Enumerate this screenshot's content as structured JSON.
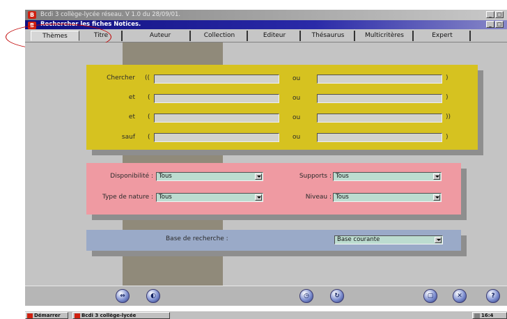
{
  "window": {
    "title": "Bcdi 3 collège-lycée réseau. V 1.0 du 28/09/01.",
    "inner_title": "Rechercher les fiches Notices."
  },
  "tabs": [
    {
      "label": "Thèmes",
      "active": true
    },
    {
      "label": "Titre"
    },
    {
      "label": "Auteur"
    },
    {
      "label": "Collection"
    },
    {
      "label": "Editeur"
    },
    {
      "label": "Thésaurus"
    },
    {
      "label": "Multicritères"
    },
    {
      "label": "Expert"
    }
  ],
  "search": {
    "rows": [
      {
        "label": "Chercher",
        "open": "((",
        "or": "ou",
        "close": ")"
      },
      {
        "label": "et",
        "open": "(",
        "or": "ou",
        "close": ")"
      },
      {
        "label": "et",
        "open": "(",
        "or": "ou",
        "close": "))"
      },
      {
        "label": "sauf",
        "open": "(",
        "or": "ou",
        "close": ")"
      }
    ]
  },
  "filters": {
    "disponibilite": {
      "label": "Disponibilité :",
      "value": "Tous"
    },
    "supports": {
      "label": "Supports :",
      "value": "Tous"
    },
    "type_nature": {
      "label": "Type de nature :",
      "value": "Tous"
    },
    "niveau": {
      "label": "Niveau :",
      "value": "Tous"
    }
  },
  "base": {
    "label": "Base de recherche :",
    "value": "Base courante"
  },
  "taskbar": {
    "start": "Démarrer",
    "app": "Bcdi 3 collège-lycée",
    "clock": "16:4"
  },
  "colors": {
    "search_panel": "#d6c220",
    "filter_panel": "#ef9aa2",
    "base_panel": "#9aaac8",
    "title_bar": "#101080"
  }
}
